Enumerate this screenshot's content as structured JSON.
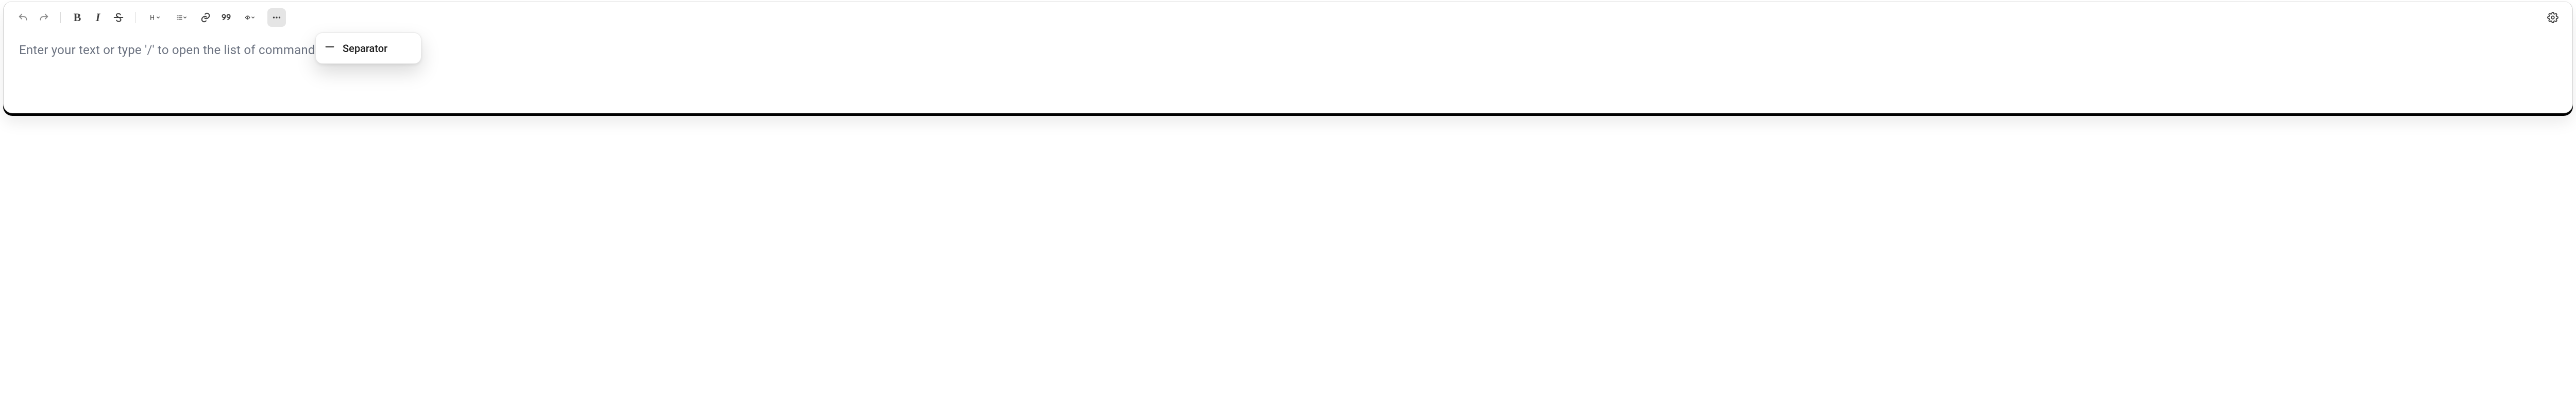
{
  "toolbar": {
    "bold_label": "B",
    "italic_label": "I"
  },
  "content": {
    "placeholder": "Enter your text or type '/' to open the list of commands"
  },
  "dropdown": {
    "items": [
      {
        "label": "Separator"
      }
    ]
  }
}
